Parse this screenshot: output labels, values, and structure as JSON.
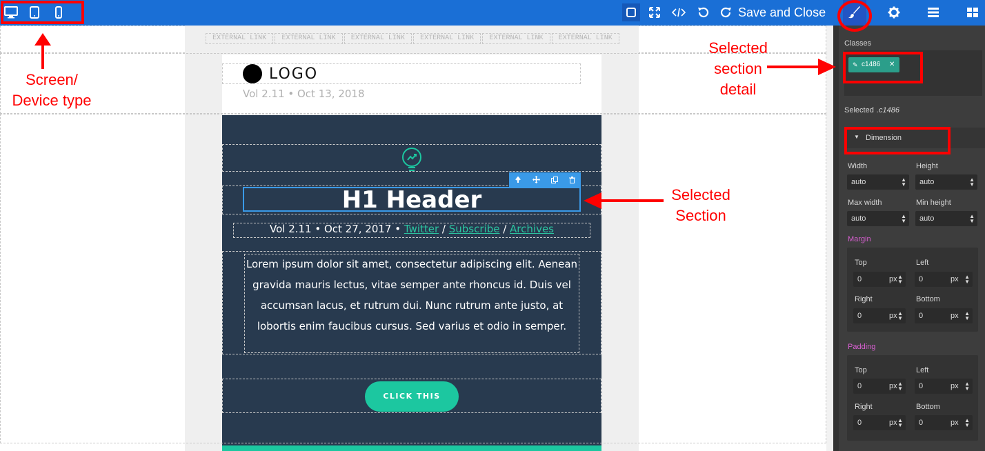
{
  "topbar": {
    "device_icons": [
      "desktop-icon",
      "tablet-icon",
      "mobile-icon"
    ],
    "tool_icons": [
      "square-icon",
      "fullscreen-icon",
      "code-icon",
      "undo-icon",
      "redo-icon"
    ],
    "save_label": "Save and Close",
    "panel_icons": [
      "brush-icon",
      "gear-icon",
      "menu-icon",
      "blocks-icon"
    ],
    "bg_color": "#1a6fd6"
  },
  "canvas": {
    "external_links": [
      "EXTERNAL LINK",
      "EXTERNAL LINK",
      "EXTERNAL LINK",
      "EXTERNAL LINK",
      "EXTERNAL LINK",
      "EXTERNAL LINK"
    ],
    "logo_text": "LOGO",
    "vol_top": "Vol 2.11 • Oct 13, 2018",
    "h1": "H1 Header",
    "meta_prefix": "Vol 2.11 • Oct 27, 2017 • ",
    "meta_links": [
      "Twitter",
      "Subscribe",
      "Archives"
    ],
    "meta_sep": " / ",
    "lorem": "Lorem ipsum dolor sit amet, consectetur adipiscing elit. Aenean gravida mauris lectus, vitae semper ante rhoncus id. Duis vel accumsan lacus, et rutrum dui. Nunc rutrum ante justo, at lobortis enim faucibus cursus. Sed varius et odio in semper.",
    "cta": "CLICK THIS",
    "accent_color": "#1cc7a0",
    "dark_bg": "#283a4f"
  },
  "panel": {
    "classes_label": "Classes",
    "class_tag": "c1486",
    "selected_label": "Selected",
    "selected_value": ".c1486",
    "dimension_label": "Dimension",
    "width_label": "Width",
    "width_value": "auto",
    "height_label": "Height",
    "height_value": "auto",
    "max_width_label": "Max width",
    "max_width_value": "auto",
    "min_height_label": "Min height",
    "min_height_value": "auto",
    "margin_label": "Margin",
    "padding_label": "Padding",
    "top_label": "Top",
    "left_label": "Left",
    "right_label": "Right",
    "bottom_label": "Bottom",
    "zero": "0",
    "unit": "px"
  },
  "annotations": {
    "device_type": "Screen/\nDevice type",
    "section_detail": "Selected\nsection\ndetail",
    "selected_section": "Selected\nSection",
    "color": "#ff0000"
  }
}
